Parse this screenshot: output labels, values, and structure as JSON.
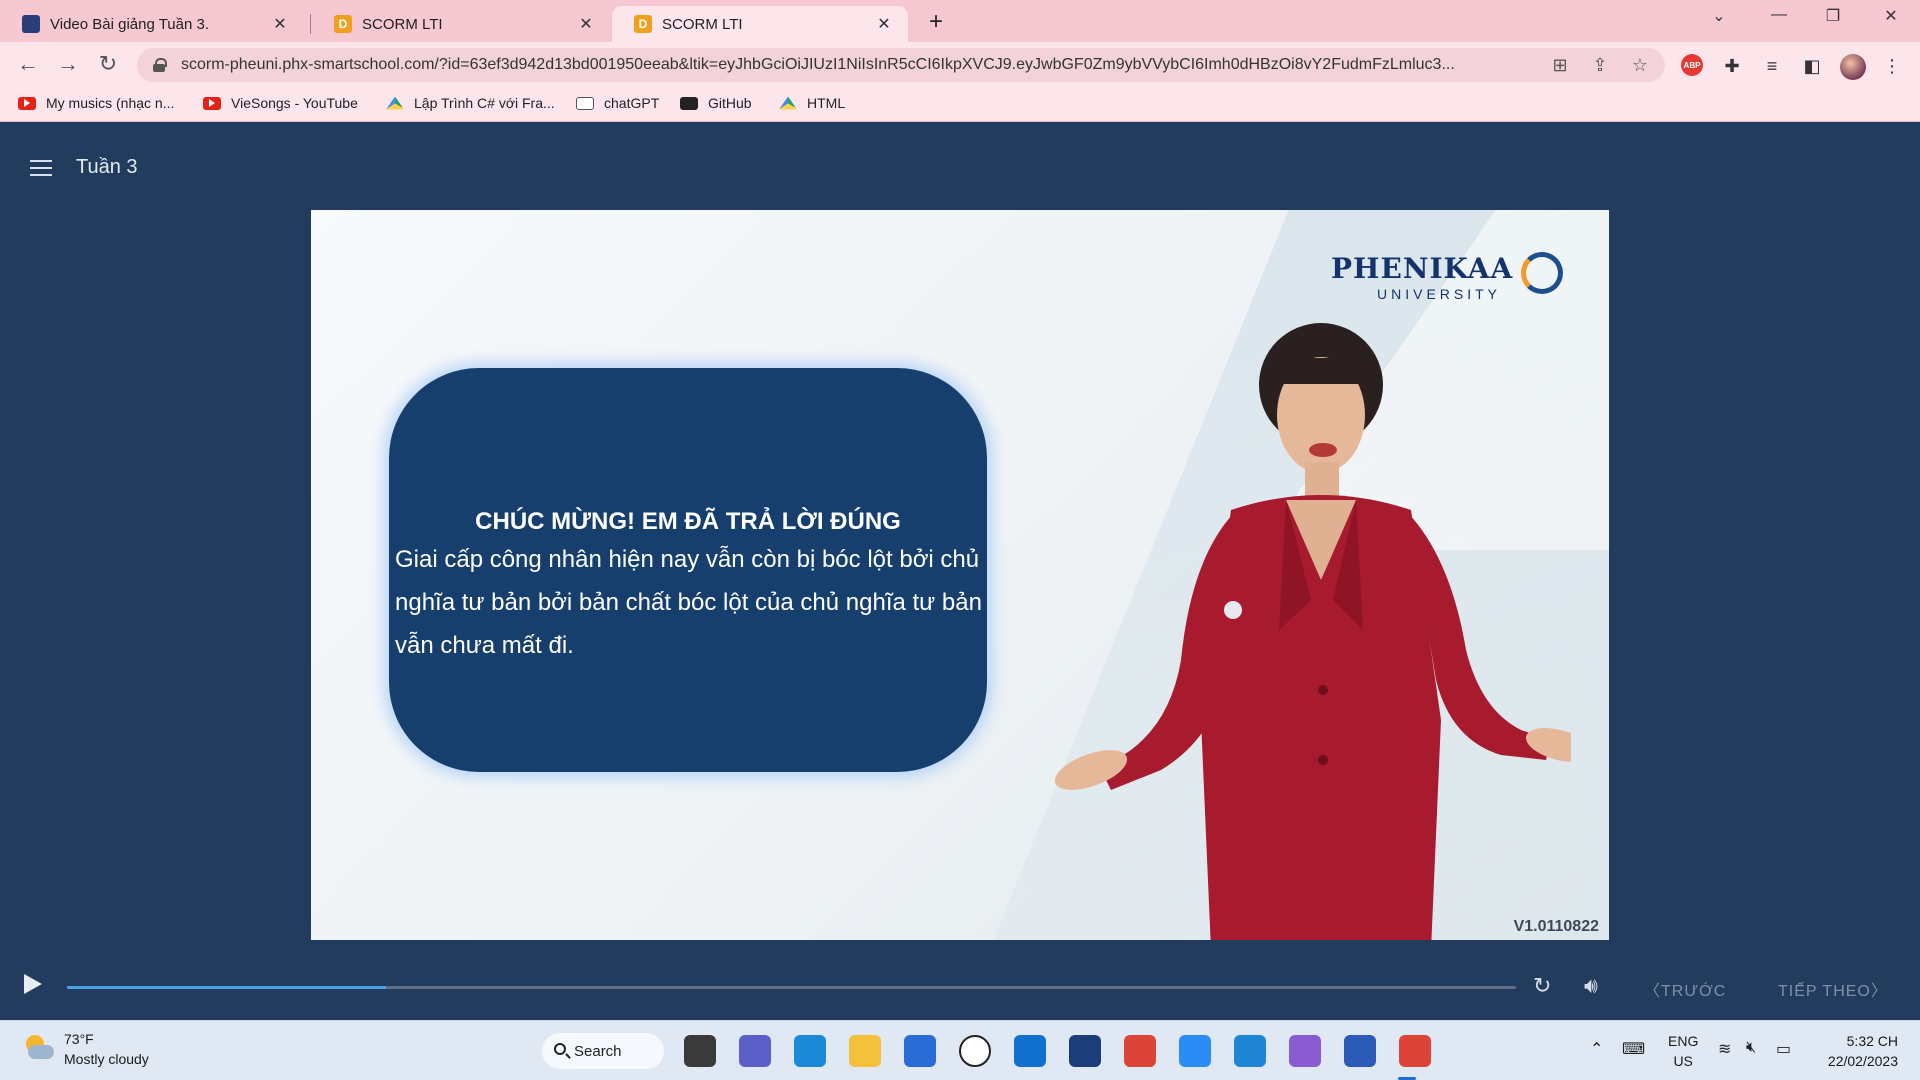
{
  "browser": {
    "tabs": [
      {
        "title": "Video Bài giảng Tuần 3.",
        "favicon_color": "#2c3e7a",
        "active": false
      },
      {
        "title": "SCORM LTI",
        "favicon_color": "#f0a020",
        "favicon_letter": "D",
        "active": false
      },
      {
        "title": "SCORM LTI",
        "favicon_color": "#f0a020",
        "favicon_letter": "D",
        "active": true
      }
    ],
    "new_tab": "+",
    "url": "scorm-pheuni.phx-smartschool.com/?id=63ef3d942d13bd001950eeab&ltik=eyJhbGciOiJIUzI1NiIsInR5cCI6IkpXVCJ9.eyJwbGF0Zm9ybVVybCI6Imh0dHBzOi8vY2FudmFzLmluc3...",
    "bookmarks": [
      {
        "label": "My musics (nhạc n...",
        "icon": "youtube-icon"
      },
      {
        "label": "VieSongs - YouTube",
        "icon": "youtube-icon"
      },
      {
        "label": "Lập Trình C# với Fra...",
        "icon": "google-drive-icon"
      },
      {
        "label": "chatGPT",
        "icon": "chatgpt-icon"
      },
      {
        "label": "GitHub",
        "icon": "github-icon"
      },
      {
        "label": "HTML",
        "icon": "google-drive-icon"
      }
    ],
    "extension_abp": "ABP"
  },
  "player": {
    "lesson_title": "Tuần 3",
    "feedback": {
      "title": "CHÚC MỪNG! EM ĐÃ TRẢ LỜI ĐÚNG",
      "body": "Giai cấp công nhân hiện nay vẫn còn bị bóc lột bởi chủ nghĩa tư bản bởi bản chất bóc lột của chủ nghĩa tư bản vẫn chưa mất đi."
    },
    "logo": {
      "name": "PHENIKAA",
      "sub": "UNIVERSITY"
    },
    "version": "V1.0110822",
    "progress": 0.22,
    "prev_label": "TRƯỚC",
    "next_label": "TIẾP THEO",
    "accent_color": "#4aa3e6"
  },
  "taskbar": {
    "weather_temp": "73°F",
    "weather_desc": "Mostly cloudy",
    "search_label": "Search",
    "apps": [
      {
        "name": "task-view-icon",
        "color": "#3a3a3a"
      },
      {
        "name": "teams-chat-icon",
        "color": "#5b5fc7"
      },
      {
        "name": "edge-icon",
        "color": "#1b8ad6"
      },
      {
        "name": "file-explorer-icon",
        "color": "#f3c13a"
      },
      {
        "name": "store-icon",
        "color": "#2b6bd6"
      },
      {
        "name": "dell-icon",
        "color": "#ffffff"
      },
      {
        "name": "app-blue-icon",
        "color": "#1070d0"
      },
      {
        "name": "dev-home-icon",
        "color": "#1c3d7a"
      },
      {
        "name": "chrome-icon",
        "color": "#db4437"
      },
      {
        "name": "zalo-icon",
        "color": "#2b8cf5"
      },
      {
        "name": "vscode-icon",
        "color": "#1f86d6"
      },
      {
        "name": "visual-studio-icon",
        "color": "#8a5cd1"
      },
      {
        "name": "word-icon",
        "color": "#2b5bb7"
      },
      {
        "name": "chrome-profile-icon",
        "color": "#db4437"
      }
    ],
    "lang_top": "ENG",
    "lang_bottom": "US",
    "time": "5:32 CH",
    "date": "22/02/2023"
  }
}
